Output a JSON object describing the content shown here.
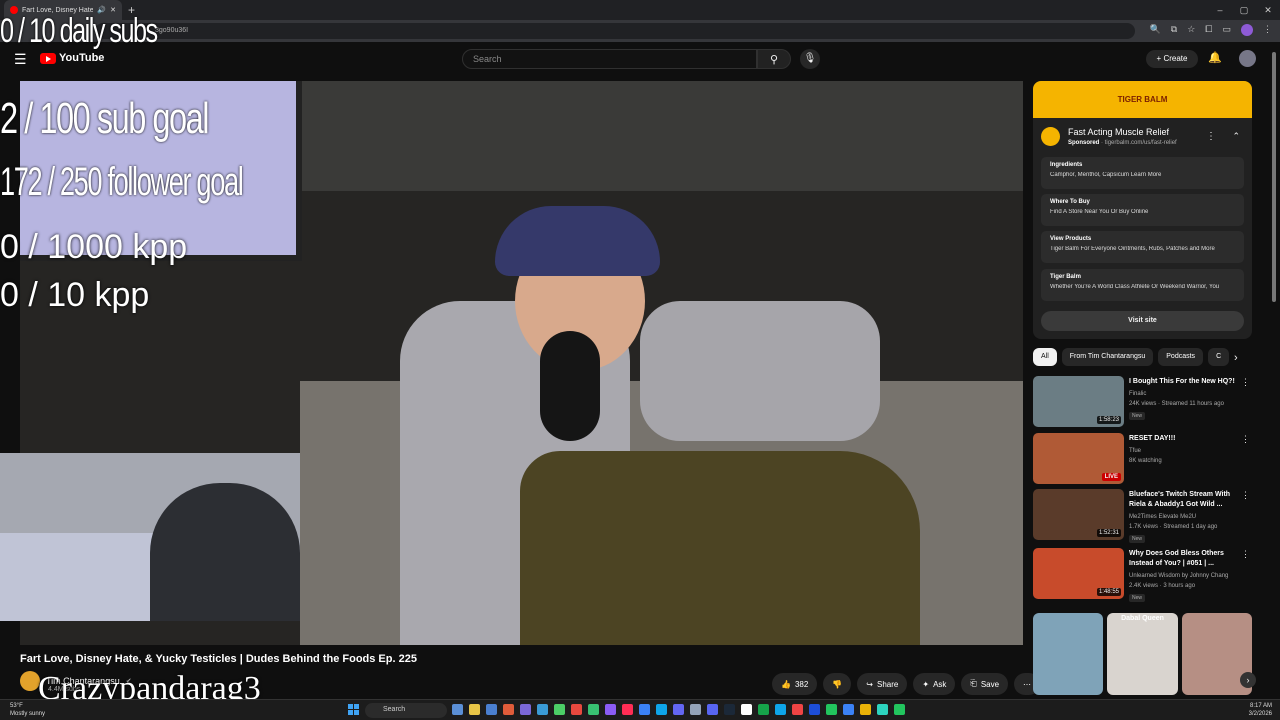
{
  "browser": {
    "tab_title": "Fart Love, Disney Hate, &",
    "new_tab": "+",
    "url_fragment": "3go90u36I",
    "window_controls": [
      "–",
      "▢",
      "✕"
    ]
  },
  "youtube": {
    "logo_text": "YouTube",
    "search_placeholder": "Search",
    "create_label": "Create"
  },
  "overlays": {
    "daily_subs": "0 / 10 daily subs",
    "sub_goal": "2  / 100 sub goal",
    "follower_goal": "172 / 250 follower goal",
    "kpp_1000": "0 / 1000 kpp",
    "kpp_10": "0 / 10 kpp",
    "watermark": "Crazypandarag3"
  },
  "video": {
    "title": "Fart Love, Disney Hate, & Yucky Testicles | Dudes Behind the Foods Ep. 225",
    "channel": "Tim Chantarangsu",
    "subscribers": "4.4M subs",
    "likes": "382",
    "share_label": "Share",
    "ask_label": "Ask",
    "save_label": "Save"
  },
  "ad": {
    "banner_text": "TIGER BALM",
    "title": "Fast Acting Muscle Relief",
    "sponsored": "Sponsored",
    "domain": "tigerbalm.com/us/fast-relief",
    "links": [
      {
        "heading": "Ingredients",
        "desc": "Camphor, Menthol, Capsicum Learn More"
      },
      {
        "heading": "Where To Buy",
        "desc": "Find A Store Near You Or Buy Online"
      },
      {
        "heading": "View Products",
        "desc": "Tiger Balm For Everyone Ointments, Rubs, Patches and More"
      },
      {
        "heading": "Tiger Balm",
        "desc": "Whether You're A World Class Athlete Or Weekend Warrior, You"
      }
    ],
    "visit_label": "Visit site"
  },
  "chips": [
    "All",
    "From Tim Chantarangsu",
    "Podcasts",
    "C"
  ],
  "recommendations": [
    {
      "title": "I Bought This For the New HQ?!",
      "channel": "Finalic",
      "meta": "24K views · Streamed 11 hours ago",
      "badge": "New",
      "duration": "1:58:23",
      "thumb_color": "#6b7d84"
    },
    {
      "title": "RESET DAY!!!",
      "channel": "Tfue",
      "meta": "8K watching",
      "badge": "",
      "duration": "LIVE",
      "thumb_color": "#b05a36"
    },
    {
      "title": "Blueface's Twitch Stream With Riela & Abaddy1 Got Wild ...",
      "channel": "Me2Times Elevate Me2U",
      "meta": "1.7K views · Streamed 1 day ago",
      "badge": "New",
      "duration": "1:52:31",
      "thumb_color": "#5a3b2a"
    },
    {
      "title": "Why Does God Bless Others Instead of You? | #051 | ...",
      "channel": "Unlearned Wisdom by Johnny Chang",
      "meta": "2.4K views · 3 hours ago",
      "badge": "New",
      "duration": "1:48:55",
      "thumb_color": "#c84b2b"
    }
  ],
  "shorts": [
    {
      "label": "",
      "color": "#7fa3b8"
    },
    {
      "label": "Dabal Queen",
      "color": "#d9d4cf"
    },
    {
      "label": "",
      "color": "#b68f84"
    }
  ],
  "taskbar": {
    "temp": "53°F",
    "weather": "Mostly sunny",
    "search": "Search",
    "time": "8:17 AM",
    "date": "3/2/2026",
    "icon_colors": [
      "#5b8fd6",
      "#e8c547",
      "#4a7fd0",
      "#e05c3a",
      "#7b68d8",
      "#3a9bd6",
      "#4ccf67",
      "#e8493f",
      "#38c172",
      "#8b5cf6",
      "#ff2d55",
      "#3b82f6",
      "#0ea5e9",
      "#6366f1",
      "#94a3b8",
      "#5865f2",
      "#1b2838",
      "#ffffff",
      "#16a34a",
      "#0ea5e9",
      "#ef4444",
      "#1d4ed8",
      "#22c55e",
      "#3b82f6",
      "#eab308",
      "#2dd4bf",
      "#22c55e"
    ]
  }
}
